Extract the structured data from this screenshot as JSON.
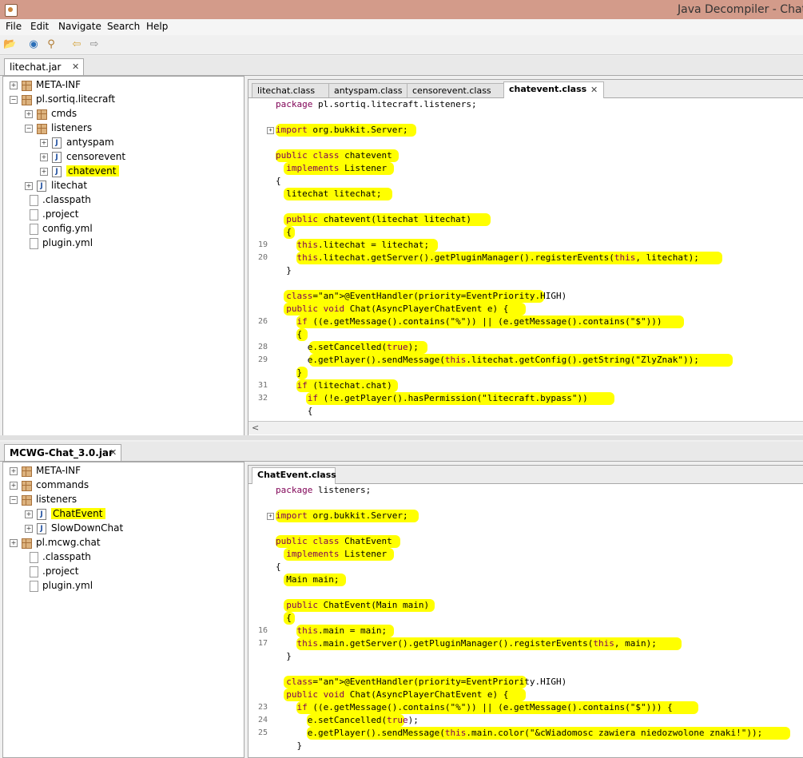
{
  "window": {
    "title": "Java Decompiler - ChatE"
  },
  "menu": [
    "File",
    "Edit",
    "Navigate",
    "Search",
    "Help"
  ],
  "toolbar_icons": [
    "open-folder-icon",
    "open-type-icon",
    "search-icon",
    "back-arrow-icon",
    "forward-arrow-icon"
  ],
  "top": {
    "jar_tab": "litechat.jar",
    "tree": [
      {
        "label": "META-INF",
        "type": "package",
        "indent": 0,
        "toggle": "+"
      },
      {
        "label": "pl.sortiq.litecraft",
        "type": "package",
        "indent": 0,
        "toggle": "-"
      },
      {
        "label": "cmds",
        "type": "package",
        "indent": 1,
        "toggle": "+"
      },
      {
        "label": "listeners",
        "type": "package",
        "indent": 1,
        "toggle": "-"
      },
      {
        "label": "antyspam",
        "type": "class",
        "indent": 2,
        "toggle": "+"
      },
      {
        "label": "censorevent",
        "type": "class",
        "indent": 2,
        "toggle": "+"
      },
      {
        "label": "chatevent",
        "type": "class",
        "indent": 2,
        "toggle": "+",
        "selected": true
      },
      {
        "label": "litechat",
        "type": "class",
        "indent": 1,
        "toggle": "+"
      },
      {
        "label": ".classpath",
        "type": "file",
        "indent": 0
      },
      {
        "label": ".project",
        "type": "file",
        "indent": 0
      },
      {
        "label": "config.yml",
        "type": "file",
        "indent": 0
      },
      {
        "label": "plugin.yml",
        "type": "file",
        "indent": 0
      }
    ],
    "file_tabs": [
      "litechat.class",
      "antyspam.class",
      "censorevent.class",
      "chatevent.class"
    ],
    "active_tab": "chatevent.class",
    "code": [
      {
        "n": "",
        "t": "package pl.sortiq.litecraft.listeners;"
      },
      {
        "n": "",
        "t": ""
      },
      {
        "n": "",
        "t": "import org.bukkit.Server;",
        "fold": true
      },
      {
        "n": "",
        "t": ""
      },
      {
        "n": "",
        "t": "public class chatevent"
      },
      {
        "n": "",
        "t": "  implements Listener"
      },
      {
        "n": "",
        "t": "{"
      },
      {
        "n": "",
        "t": "  litechat litechat;"
      },
      {
        "n": "",
        "t": ""
      },
      {
        "n": "",
        "t": "  public chatevent(litechat litechat)"
      },
      {
        "n": "",
        "t": "  {"
      },
      {
        "n": "19",
        "t": "    this.litechat = litechat;"
      },
      {
        "n": "20",
        "t": "    this.litechat.getServer().getPluginManager().registerEvents(this, litechat);"
      },
      {
        "n": "",
        "t": "  }"
      },
      {
        "n": "",
        "t": ""
      },
      {
        "n": "",
        "t": "  @EventHandler(priority=EventPriority.HIGH)"
      },
      {
        "n": "",
        "t": "  public void Chat(AsyncPlayerChatEvent e) {"
      },
      {
        "n": "26",
        "t": "    if ((e.getMessage().contains(\"%\")) || (e.getMessage().contains(\"$\")))"
      },
      {
        "n": "",
        "t": "    {"
      },
      {
        "n": "28",
        "t": "      e.setCancelled(true);"
      },
      {
        "n": "29",
        "t": "      e.getPlayer().sendMessage(this.litechat.getConfig().getString(\"ZlyZnak\"));"
      },
      {
        "n": "",
        "t": "    }"
      },
      {
        "n": "31",
        "t": "    if (litechat.chat)"
      },
      {
        "n": "32",
        "t": "      if (!e.getPlayer().hasPermission(\"litecraft.bypass\"))"
      },
      {
        "n": "",
        "t": "      {"
      }
    ]
  },
  "bottom": {
    "jar_tab": "MCWG-Chat_3.0.jar",
    "tree": [
      {
        "label": "META-INF",
        "type": "package",
        "indent": 0,
        "toggle": "+"
      },
      {
        "label": "commands",
        "type": "package",
        "indent": 0,
        "toggle": "+"
      },
      {
        "label": "listeners",
        "type": "package",
        "indent": 0,
        "toggle": "-"
      },
      {
        "label": "ChatEvent",
        "type": "class",
        "indent": 1,
        "toggle": "+",
        "selected": true
      },
      {
        "label": "SlowDownChat",
        "type": "class",
        "indent": 1,
        "toggle": "+"
      },
      {
        "label": "pl.mcwg.chat",
        "type": "package",
        "indent": 0,
        "toggle": "+"
      },
      {
        "label": ".classpath",
        "type": "file",
        "indent": 0
      },
      {
        "label": ".project",
        "type": "file",
        "indent": 0
      },
      {
        "label": "plugin.yml",
        "type": "file",
        "indent": 0
      }
    ],
    "file_tabs": [
      "ChatEvent.class"
    ],
    "active_tab": "ChatEvent.class",
    "code": [
      {
        "n": "",
        "t": "package listeners;"
      },
      {
        "n": "",
        "t": ""
      },
      {
        "n": "",
        "t": "import org.bukkit.Server;",
        "fold": true
      },
      {
        "n": "",
        "t": ""
      },
      {
        "n": "",
        "t": "public class ChatEvent"
      },
      {
        "n": "",
        "t": "  implements Listener"
      },
      {
        "n": "",
        "t": "{"
      },
      {
        "n": "",
        "t": "  Main main;"
      },
      {
        "n": "",
        "t": ""
      },
      {
        "n": "",
        "t": "  public ChatEvent(Main main)"
      },
      {
        "n": "",
        "t": "  {"
      },
      {
        "n": "16",
        "t": "    this.main = main;"
      },
      {
        "n": "17",
        "t": "    this.main.getServer().getPluginManager().registerEvents(this, main);"
      },
      {
        "n": "",
        "t": "  }"
      },
      {
        "n": "",
        "t": ""
      },
      {
        "n": "",
        "t": "  @EventHandler(priority=EventPriority.HIGH)"
      },
      {
        "n": "",
        "t": "  public void Chat(AsyncPlayerChatEvent e) {"
      },
      {
        "n": "23",
        "t": "    if ((e.getMessage().contains(\"%\")) || (e.getMessage().contains(\"$\"))) {"
      },
      {
        "n": "24",
        "t": "      e.setCancelled(true);"
      },
      {
        "n": "25",
        "t": "      e.getPlayer().sendMessage(this.main.color(\"&cWiadomosc zawiera niedozwolone znaki!\"));"
      },
      {
        "n": "",
        "t": "    }"
      }
    ]
  },
  "colors": {
    "highlight": "#ffff00",
    "keyword": "#7f0055",
    "annotation": "#646464",
    "titlebar": "#d39b8a"
  }
}
